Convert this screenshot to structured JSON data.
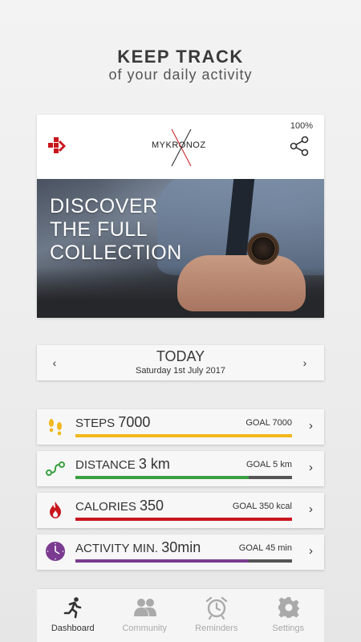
{
  "hero": {
    "title": "KEEP TRACK",
    "subtitle": "of your daily activity"
  },
  "card": {
    "brand": "MYKRONOZ",
    "battery": "100%",
    "banner_lines": [
      "DISCOVER",
      "THE FULL",
      "COLLECTION"
    ]
  },
  "date_bar": {
    "title": "TODAY",
    "date": "Saturday 1st July 2017",
    "prev_icon": "chevron-left-icon",
    "next_icon": "chevron-right-icon"
  },
  "metrics": [
    {
      "label": "STEPS",
      "value": "7000",
      "goal": "GOAL 7000",
      "progress": 1.0,
      "color": "#f1b81c",
      "icon": "footprints-icon"
    },
    {
      "label": "DISTANCE",
      "value": "3 km",
      "goal": "GOAL 5 km",
      "progress": 0.8,
      "color": "#3aa040",
      "icon": "route-icon"
    },
    {
      "label": "CALORIES",
      "value": "350",
      "goal": "GOAL 350 kcal",
      "progress": 1.0,
      "color": "#c8161d",
      "icon": "flame-icon"
    },
    {
      "label": "ACTIVITY MIN.",
      "value": "30min",
      "goal": "GOAL 45 min",
      "progress": 0.8,
      "color": "#7b3b91",
      "icon": "clock-icon"
    }
  ],
  "nav": {
    "items": [
      {
        "label": "Dashboard",
        "icon": "runner-icon",
        "active": true
      },
      {
        "label": "Community",
        "icon": "people-icon",
        "active": false
      },
      {
        "label": "Reminders",
        "icon": "alarm-clock-icon",
        "active": false
      },
      {
        "label": "Settings",
        "icon": "gear-icon",
        "active": false
      }
    ]
  },
  "colors": {
    "active": "#333333",
    "inactive": "#aaaaaa",
    "brand_red": "#c8161d"
  }
}
